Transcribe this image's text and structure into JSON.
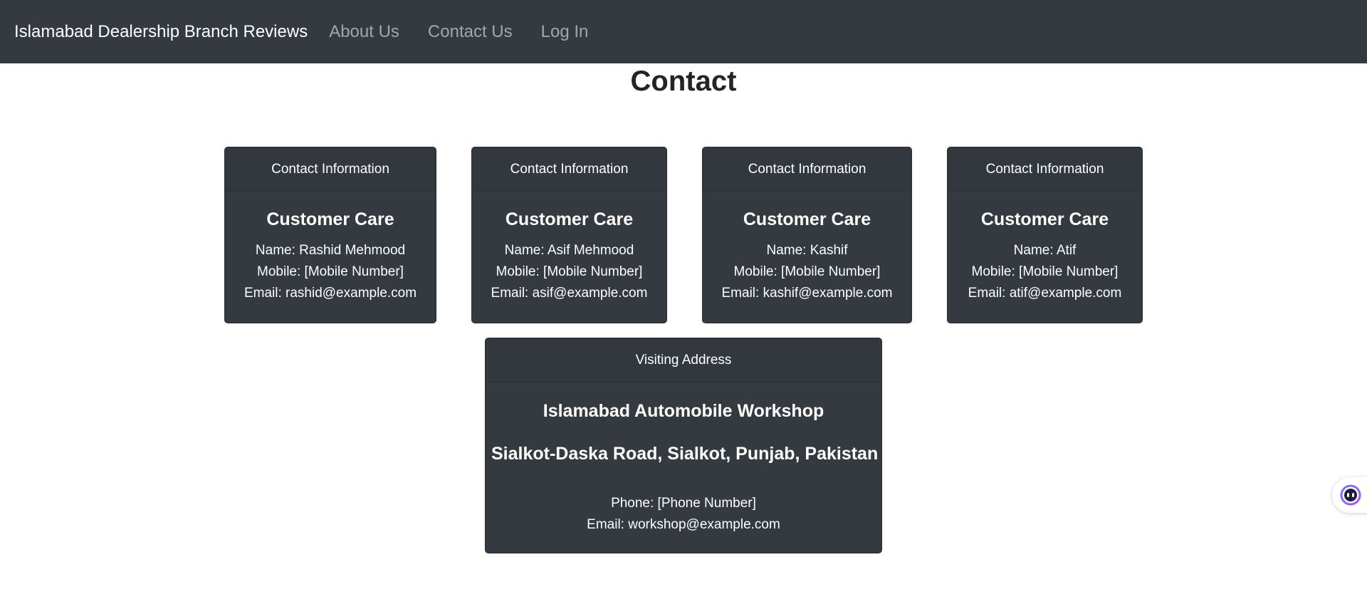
{
  "navbar": {
    "brand": "Islamabad Dealership Branch Reviews",
    "links": [
      "About Us",
      "Contact Us",
      "Log In"
    ]
  },
  "page": {
    "title": "Contact"
  },
  "contacts": [
    {
      "header": "Contact Information",
      "title": "Customer Care",
      "name": "Name: Rashid Mehmood",
      "mobile": "Mobile: [Mobile Number]",
      "email": "Email: rashid@example.com"
    },
    {
      "header": "Contact Information",
      "title": "Customer Care",
      "name": "Name: Asif Mehmood",
      "mobile": "Mobile: [Mobile Number]",
      "email": "Email: asif@example.com"
    },
    {
      "header": "Contact Information",
      "title": "Customer Care",
      "name": "Name: Kashif",
      "mobile": "Mobile: [Mobile Number]",
      "email": "Email: kashif@example.com"
    },
    {
      "header": "Contact Information",
      "title": "Customer Care",
      "name": "Name: Atif",
      "mobile": "Mobile: [Mobile Number]",
      "email": "Email: atif@example.com"
    }
  ],
  "address": {
    "header": "Visiting Address",
    "title": "Islamabad Automobile Workshop",
    "street": "Sialkot-Daska Road, Sialkot, Punjab, Pakistan",
    "phone": "Phone: [Phone Number]",
    "email": "Email: workshop@example.com"
  },
  "colors": {
    "navbar_bg": "#343a40",
    "card_bg": "#343a40",
    "assistant_accent": "#7b5cf5"
  },
  "icons": {
    "assistant": "assistant-bot-icon"
  }
}
